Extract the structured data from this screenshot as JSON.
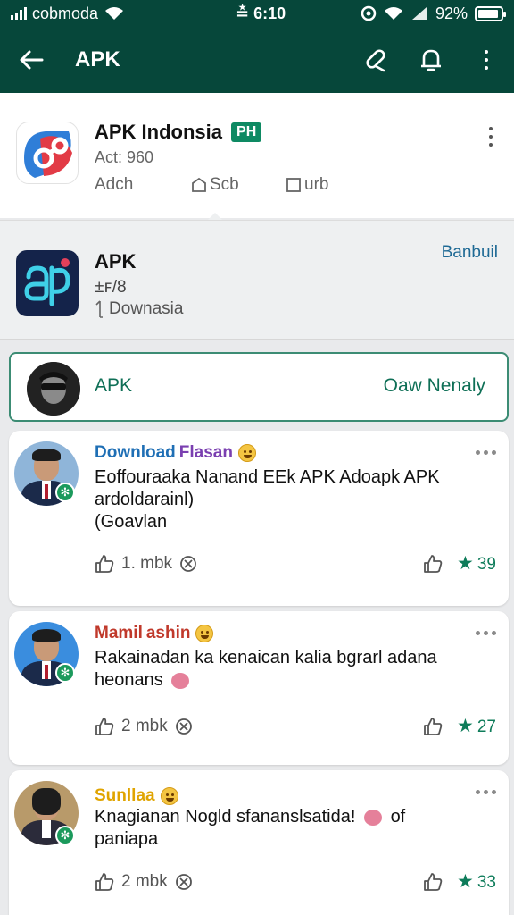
{
  "status_bar": {
    "carrier": "cobmoda",
    "time": "≛ 6:10",
    "battery": "92%",
    "battery_level": 0.92
  },
  "app_bar": {
    "title": "APK",
    "icons": [
      "back-arrow-icon",
      "link-icon",
      "bell-icon",
      "more-vert-icon"
    ]
  },
  "header_app": {
    "name": "APK Indonsia",
    "badge": "PH",
    "act": "Act:  960",
    "tabs": [
      {
        "label": "Adch",
        "icon": ""
      },
      {
        "label": "Scb",
        "icon": "home-icon"
      },
      {
        "label": "urb",
        "icon": "square-icon"
      }
    ]
  },
  "second_app": {
    "name": "APK",
    "version": "±ꜰ/8",
    "downloads": "Downasia",
    "link": "Banbuil"
  },
  "pinned": {
    "label": "APK",
    "action": "Oaw Nenaly"
  },
  "comments": [
    {
      "author_a": "Download",
      "author_b": "Flasan",
      "author_a_color": "#1f6fb5",
      "author_b_color": "#7a3fb0",
      "text": "Eoffouraaka Nanand EEk APK Adoapk APK ardoldarainl)",
      "text2": "(Goavlan",
      "likes": "1. mbk",
      "stars": "39"
    },
    {
      "author_a": "Mamil",
      "author_b": "ashin",
      "author_a_color": "#c0392b",
      "author_b_color": "#c0392b",
      "text": "Rakainadan ka kenaican kalia bgrarl adana heonans",
      "text2": "",
      "likes": "2 mbk",
      "stars": "27"
    },
    {
      "author_a": "Sunllaa",
      "author_b": "",
      "author_a_color": "#e0a400",
      "author_b_color": "#e0a400",
      "text": "Knagianan Nogld sfananslsatida!",
      "text_tail": "of",
      "text2": "paniapa",
      "likes": "2 mbk",
      "stars": "33"
    }
  ]
}
